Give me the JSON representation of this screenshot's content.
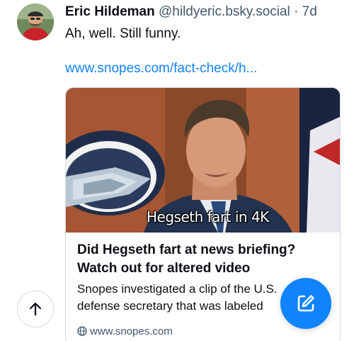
{
  "post": {
    "author_name": "Eric Hildeman",
    "author_handle": "@hildyeric.bsky.social",
    "separator": "·",
    "time": "7d",
    "text": "Ah, well. Still funny.",
    "link_text": "www.snopes.com/fact-check/h..."
  },
  "embed": {
    "image_caption": "Hegseth fart in 4K",
    "title": "Did Hegseth fart at news briefing? Watch out for altered video",
    "description": "Snopes investigated a clip of the U.S. defense secretary that was labeled",
    "domain": "www.snopes.com",
    "domain_icon": "globe-icon"
  },
  "controls": {
    "scroll_top_icon": "arrow-up-icon",
    "compose_icon": "compose-icon"
  },
  "colors": {
    "accent": "#1083fe",
    "text_primary": "#0b0f14",
    "text_secondary": "#42576c",
    "border": "#d4dbe2"
  }
}
